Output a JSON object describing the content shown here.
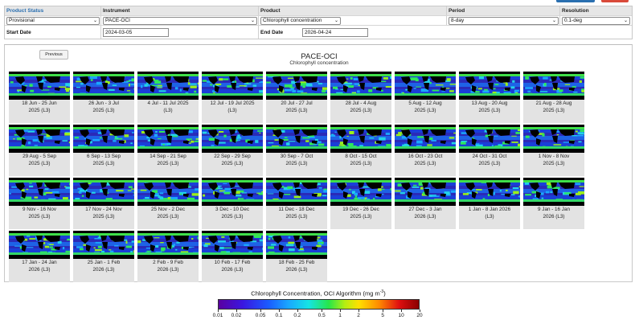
{
  "form": {
    "headers": {
      "product_status": "Product Status",
      "instrument": "Instrument",
      "product": "Product",
      "period": "Period",
      "resolution": "Resolution"
    },
    "values": {
      "product_status": "Provisional",
      "instrument": "PACE-OCI",
      "product": "Chlorophyll concentration",
      "period": "8-day",
      "resolution": "0.1-deg"
    },
    "start_date_label": "Start Date",
    "start_date": "2024-03-05",
    "end_date_label": "End Date",
    "end_date": "2026-04-24"
  },
  "panel": {
    "previous_label": "Previous",
    "title": "PACE-OCI",
    "subtitle": "Chlorophyll concentration"
  },
  "tiles": [
    {
      "l1": "18 Jun - 25 Jun",
      "l2": "2025 (L3)"
    },
    {
      "l1": "26 Jun - 3 Jul",
      "l2": "2025 (L3)"
    },
    {
      "l1": "4 Jul - 11 Jul 2025",
      "l2": "(L3)"
    },
    {
      "l1": "12 Jul - 19 Jul 2025",
      "l2": "(L3)"
    },
    {
      "l1": "20 Jul - 27 Jul",
      "l2": "2025 (L3)"
    },
    {
      "l1": "28 Jul - 4 Aug",
      "l2": "2025 (L3)"
    },
    {
      "l1": "5 Aug - 12 Aug",
      "l2": "2025 (L3)"
    },
    {
      "l1": "13 Aug - 20 Aug",
      "l2": "2025 (L3)"
    },
    {
      "l1": "21 Aug - 28 Aug",
      "l2": "2025 (L3)"
    },
    {
      "l1": "29 Aug - 5 Sep",
      "l2": "2025 (L3)"
    },
    {
      "l1": "6 Sep - 13 Sep",
      "l2": "2025 (L3)"
    },
    {
      "l1": "14 Sep - 21 Sep",
      "l2": "2025 (L3)"
    },
    {
      "l1": "22 Sep - 29 Sep",
      "l2": "2025 (L3)"
    },
    {
      "l1": "30 Sep - 7 Oct",
      "l2": "2025 (L3)"
    },
    {
      "l1": "8 Oct - 15 Oct",
      "l2": "2025 (L3)"
    },
    {
      "l1": "16 Oct - 23 Oct",
      "l2": "2025 (L3)"
    },
    {
      "l1": "24 Oct - 31 Oct",
      "l2": "2025 (L3)"
    },
    {
      "l1": "1 Nov - 8 Nov",
      "l2": "2025 (L3)"
    },
    {
      "l1": "9 Nov - 16 Nov",
      "l2": "2025 (L3)"
    },
    {
      "l1": "17 Nov - 24 Nov",
      "l2": "2025 (L3)"
    },
    {
      "l1": "25 Nov - 2 Dec",
      "l2": "2025 (L3)"
    },
    {
      "l1": "3 Dec - 10 Dec",
      "l2": "2025 (L3)"
    },
    {
      "l1": "11 Dec - 18 Dec",
      "l2": "2025 (L3)"
    },
    {
      "l1": "19 Dec - 26 Dec",
      "l2": "2025 (L3)"
    },
    {
      "l1": "27 Dec - 3 Jan",
      "l2": "2026 (L3)"
    },
    {
      "l1": "1 Jan - 8 Jan 2026",
      "l2": "(L3)"
    },
    {
      "l1": "9 Jan - 16 Jan",
      "l2": "2026 (L3)"
    },
    {
      "l1": "17 Jan - 24 Jan",
      "l2": "2026 (L3)"
    },
    {
      "l1": "25 Jan - 1 Feb",
      "l2": "2026 (L3)"
    },
    {
      "l1": "2 Feb - 9 Feb",
      "l2": "2026 (L3)"
    },
    {
      "l1": "10 Feb - 17 Feb",
      "l2": "2026 (L3)"
    },
    {
      "l1": "18 Feb - 25 Feb",
      "l2": "2026 (L3)"
    }
  ],
  "colorbar": {
    "title": "Chlorophyll Concentration, OCI Algorithm (mg m",
    "title_exp": "-3",
    "title_close": ")",
    "ticks": [
      "0.01",
      "0.02",
      "0.05",
      "0.1",
      "0.2",
      "0.5",
      "1",
      "2",
      "5",
      "10",
      "20"
    ]
  },
  "colors": {
    "accent": "#2a6fb0",
    "header_bg": "#e6e6e6",
    "tile_bg": "#e3e3e3"
  }
}
